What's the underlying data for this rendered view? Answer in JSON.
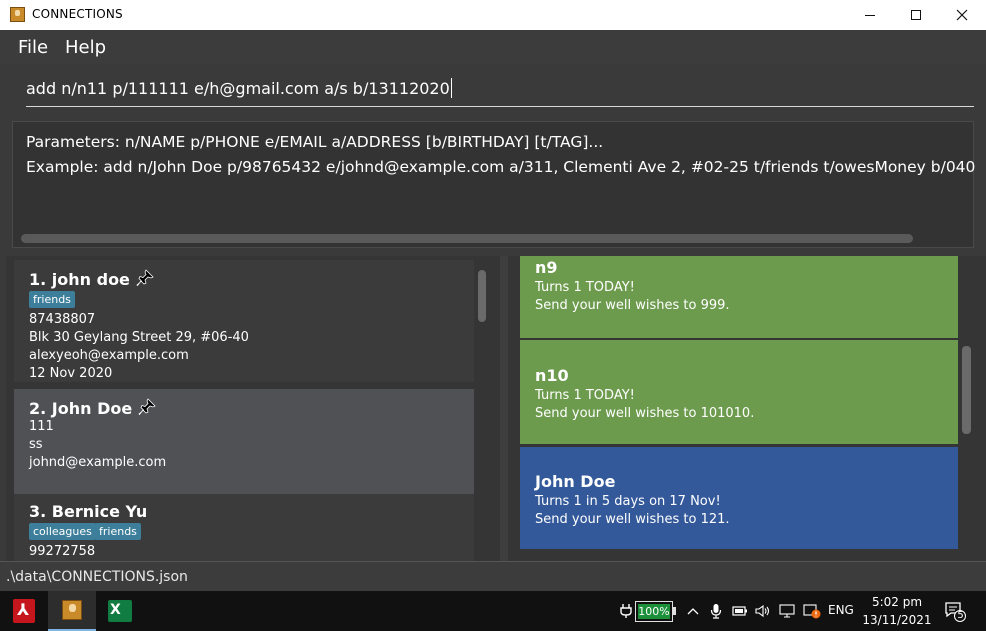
{
  "window": {
    "title": "CONNECTIONS"
  },
  "menu": {
    "file": "File",
    "help": "Help"
  },
  "command": {
    "value": "add n/n11 p/111111 e/h@gmail.com a/s b/13112020"
  },
  "result": {
    "line1": "Parameters: n/NAME p/PHONE e/EMAIL a/ADDRESS [b/BIRTHDAY] [t/TAG]...",
    "line2": "Example: add n/John Doe p/98765432 e/johnd@example.com a/311, Clementi Ave 2, #02-25 t/friends t/owesMoney b/040"
  },
  "persons": [
    {
      "title": "1.  john doe",
      "pinned": true,
      "tags": [
        "friends"
      ],
      "phone": "87438807",
      "address": "Blk 30 Geylang Street 29, #06-40",
      "email": "alexyeoh@example.com",
      "birthday": "12 Nov 2020"
    },
    {
      "title": "2.  John Doe",
      "pinned": true,
      "tags": [],
      "phone": "111",
      "address": "ss",
      "email": "johnd@example.com",
      "birthday": ""
    },
    {
      "title": "3.  Bernice Yu",
      "pinned": false,
      "tags": [
        "colleagues",
        "friends"
      ],
      "phone": "99272758",
      "address": "",
      "email": "",
      "birthday": ""
    }
  ],
  "birthdays": [
    {
      "name": "n9",
      "line1": "Turns 1 TODAY!",
      "line2": "Send your well wishes to 999.",
      "color": "#6d9b4e"
    },
    {
      "name": "n10",
      "line1": "Turns 1 TODAY!",
      "line2": "Send your well wishes to 101010.",
      "color": "#6d9b4e"
    },
    {
      "name": "John Doe",
      "line1": "Turns 1 in 5 days on 17 Nov!",
      "line2": "Send your well wishes to 121.",
      "color": "#33599a"
    }
  ],
  "status": {
    "path": ".\\data\\CONNECTIONS.json"
  },
  "taskbar": {
    "battery": "100%",
    "language": "ENG",
    "time": "5:02 pm",
    "date": "13/11/2021",
    "notifications": "5"
  }
}
